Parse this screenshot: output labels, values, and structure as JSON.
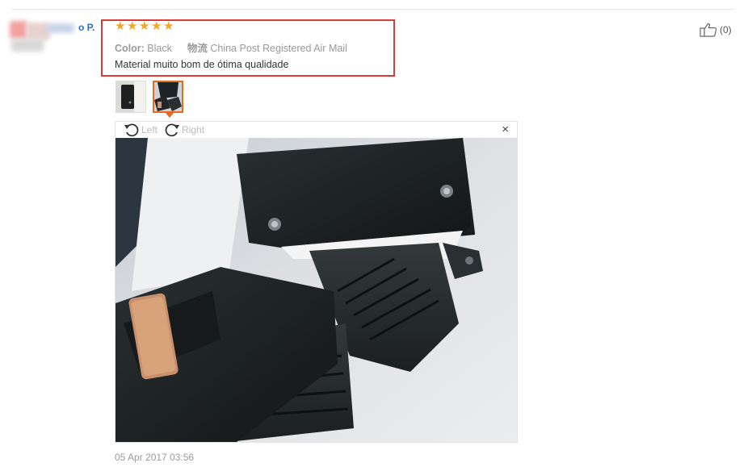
{
  "user": {
    "name_suffix": "o P."
  },
  "review": {
    "rating": 5,
    "color_label": "Color:",
    "color_value": "Black",
    "shipping_label": "物流",
    "shipping_value": "China Post Registered Air Mail",
    "text": "Material muito bom de ótima qualidade",
    "date": "05 Apr 2017 03:56"
  },
  "like": {
    "count": "(0)"
  },
  "viewer": {
    "rotate_left_label": "Left",
    "rotate_right_label": "Right",
    "close_glyph": "×"
  },
  "colors": {
    "highlight_border": "#d93b3b",
    "star": "#f5a623",
    "active_thumb": "#e56a1c",
    "user_link": "#2a6fbd"
  }
}
